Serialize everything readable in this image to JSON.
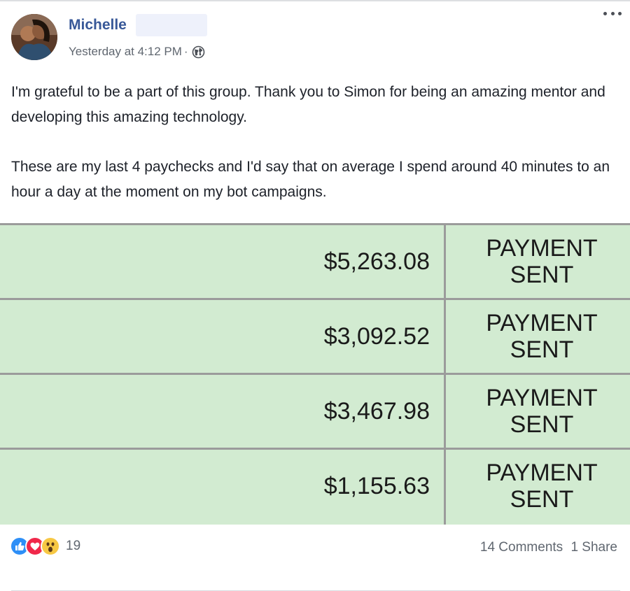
{
  "post": {
    "author": "Michelle",
    "timestamp": "Yesterday at 4:12 PM",
    "separator": "·",
    "privacy_icon": "globe-icon",
    "menu_icon": "more-icon",
    "paragraphs": [
      "I'm grateful to be a part of this group. Thank you to Simon for being an amazing mentor and developing this amazing technology.",
      "These are my last 4 paychecks and I'd say that on average I spend around 40 minutes to an hour a day at the moment on my bot campaigns."
    ]
  },
  "paychecks": [
    {
      "amount": "$5,263.08",
      "status_line1": "PAYMENT",
      "status_line2": "SENT"
    },
    {
      "amount": "$3,092.52",
      "status_line1": "PAYMENT",
      "status_line2": "SENT"
    },
    {
      "amount": "$3,467.98",
      "status_line1": "PAYMENT",
      "status_line2": "SENT"
    },
    {
      "amount": "$1,155.63",
      "status_line1": "PAYMENT",
      "status_line2": "SENT"
    }
  ],
  "footer": {
    "reactions": [
      "like-icon",
      "love-icon",
      "wow-icon"
    ],
    "reaction_count": "19",
    "comments": "14 Comments",
    "shares": "1 Share"
  },
  "colors": {
    "author_link": "#385898",
    "table_bg": "#d2ebd1",
    "table_border": "#9b9b9b",
    "like": "#2e8ff7",
    "love": "#f0284a",
    "wow": "#f7c844"
  }
}
